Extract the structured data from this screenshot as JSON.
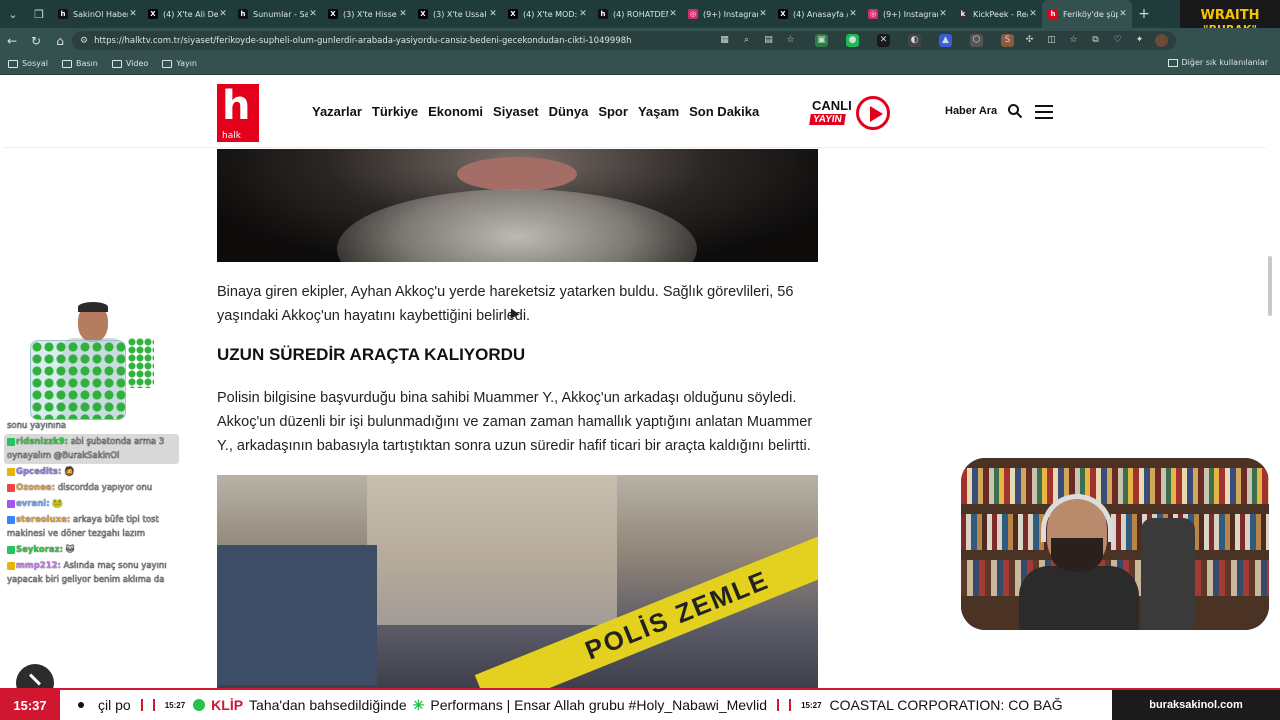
{
  "browser": {
    "tabs": [
      {
        "label": "SakinOl Haber",
        "fav_color": "#111111",
        "fav_text": "h"
      },
      {
        "label": "(4) X'te Ali Der",
        "fav_color": "#000000",
        "fav_text": "X"
      },
      {
        "label": "Sunumlar - Sak",
        "fav_color": "#111111",
        "fav_text": "h"
      },
      {
        "label": "(3) X'te Hisse P",
        "fav_color": "#000000",
        "fav_text": "X"
      },
      {
        "label": "(3) X'te Ussal S",
        "fav_color": "#000000",
        "fav_text": "X"
      },
      {
        "label": "(4) X'te MOD:",
        "fav_color": "#000000",
        "fav_text": "X"
      },
      {
        "label": "(4) ROHATDEM",
        "fav_color": "#111111",
        "fav_text": "h"
      },
      {
        "label": "(9+) Instagram",
        "fav_color": "#d62976",
        "fav_text": "◎"
      },
      {
        "label": "(4) Anasayfa /",
        "fav_color": "#000000",
        "fav_text": "X"
      },
      {
        "label": "(9+) Instagram",
        "fav_color": "#d62976",
        "fav_text": "◎"
      },
      {
        "label": "KickPeek - Rea",
        "fav_color": "#333333",
        "fav_text": "k"
      },
      {
        "label": "Feriköy'de şüp",
        "fav_color": "#e3001b",
        "fav_text": "h"
      }
    ],
    "active_tab": 11,
    "url": "https://halktv.com.tr/siyaset/ferikoyde-supheli-olum-gunlerdir-arabada-yasiyordu-cansiz-bedeni-gecekondudan-cikti-1049998h",
    "bookmarks": [
      "Sosyal",
      "Basın",
      "Video",
      "Yayın"
    ],
    "bookmarks_other": "Diğer sık kullanılanlar"
  },
  "streamer_logo": {
    "line1": "WRAITH",
    "line2": "\"BURAK\""
  },
  "site": {
    "logo_letter": "h",
    "logo_sub": "halk",
    "nav": [
      "Yazarlar",
      "Türkiye",
      "Ekonomi",
      "Siyaset",
      "Dünya",
      "Spor",
      "Yaşam",
      "Son Dakika"
    ],
    "live_line1": "CANLI",
    "live_line2": "YAYIN",
    "search_label": "Haber Ara"
  },
  "article": {
    "paragraph1": "Binaya giren ekipler, Ayhan Akkoç'u yerde hareketsiz yatarken buldu. Sağlık görevlileri, 56 yaşındaki Akkoç'un hayatını kaybettiğini belirledi.",
    "heading": "UZUN SÜREDİR ARAÇTA KALIYORDU",
    "paragraph2": "Polisin bilgisine başvurduğu bina sahibi Muammer Y., Akkoç'un arkadaşı olduğunu söyledi. Akkoç'un düzenli bir işi bulunmadığını ve zaman zaman hamallık yaptığını anlatan Muammer Y., arkadaşının babasıyla tartıştıktan sonra uzun süredir hafif ticari bir araçta kaldığını belirtti.",
    "tape_text": "POLİS ZEMLE"
  },
  "chat": [
    {
      "user": "",
      "text": "sonu yayınına",
      "user_color": "#bfbfbf",
      "highlight": false
    },
    {
      "user": "ridsnizzk9:",
      "text": "abi şubatonda arma 3 oynayalım @BurakSakinOl",
      "user_color": "#2ecc40",
      "highlight": true
    },
    {
      "user": "Gpcedits:",
      "text": "🧔",
      "user_color": "#8e7cf0",
      "highlight": false
    },
    {
      "user": "Ozonee:",
      "text": "discordda yapıyor onu",
      "user_color": "#e6a23c",
      "highlight": false
    },
    {
      "user": "evrani:",
      "text": "🐸",
      "user_color": "#6aa7ff",
      "highlight": false
    },
    {
      "user": "stereoluxe:",
      "text": "arkaya büfe tipi tost makinesi ve döner tezgahı lazım",
      "user_color": "#e6a23c",
      "highlight": false
    },
    {
      "user": "Seykoraz:",
      "text": "🐱",
      "user_color": "#2ecc40",
      "highlight": false
    },
    {
      "user": "mmp212:",
      "text": "Aslında maç sonu yayını yapacak biri geliyor benim aklıma da",
      "user_color": "#c77cf0",
      "highlight": false
    }
  ],
  "ticker": {
    "clock": "15:37",
    "segments": [
      {
        "text": "çil po",
        "time": ""
      },
      {
        "text": "Taha'dan bahsedildiğinde",
        "time": "15:27",
        "tag": "KLİP"
      },
      {
        "text": "Performans | Ensar Allah grubu #Holy_Nabawi_Mevlid",
        "time": ""
      },
      {
        "text": "COASTAL CORPORATION: CO BAĞ",
        "time": "15:27"
      }
    ],
    "site_url": "buraksakinol.com"
  }
}
